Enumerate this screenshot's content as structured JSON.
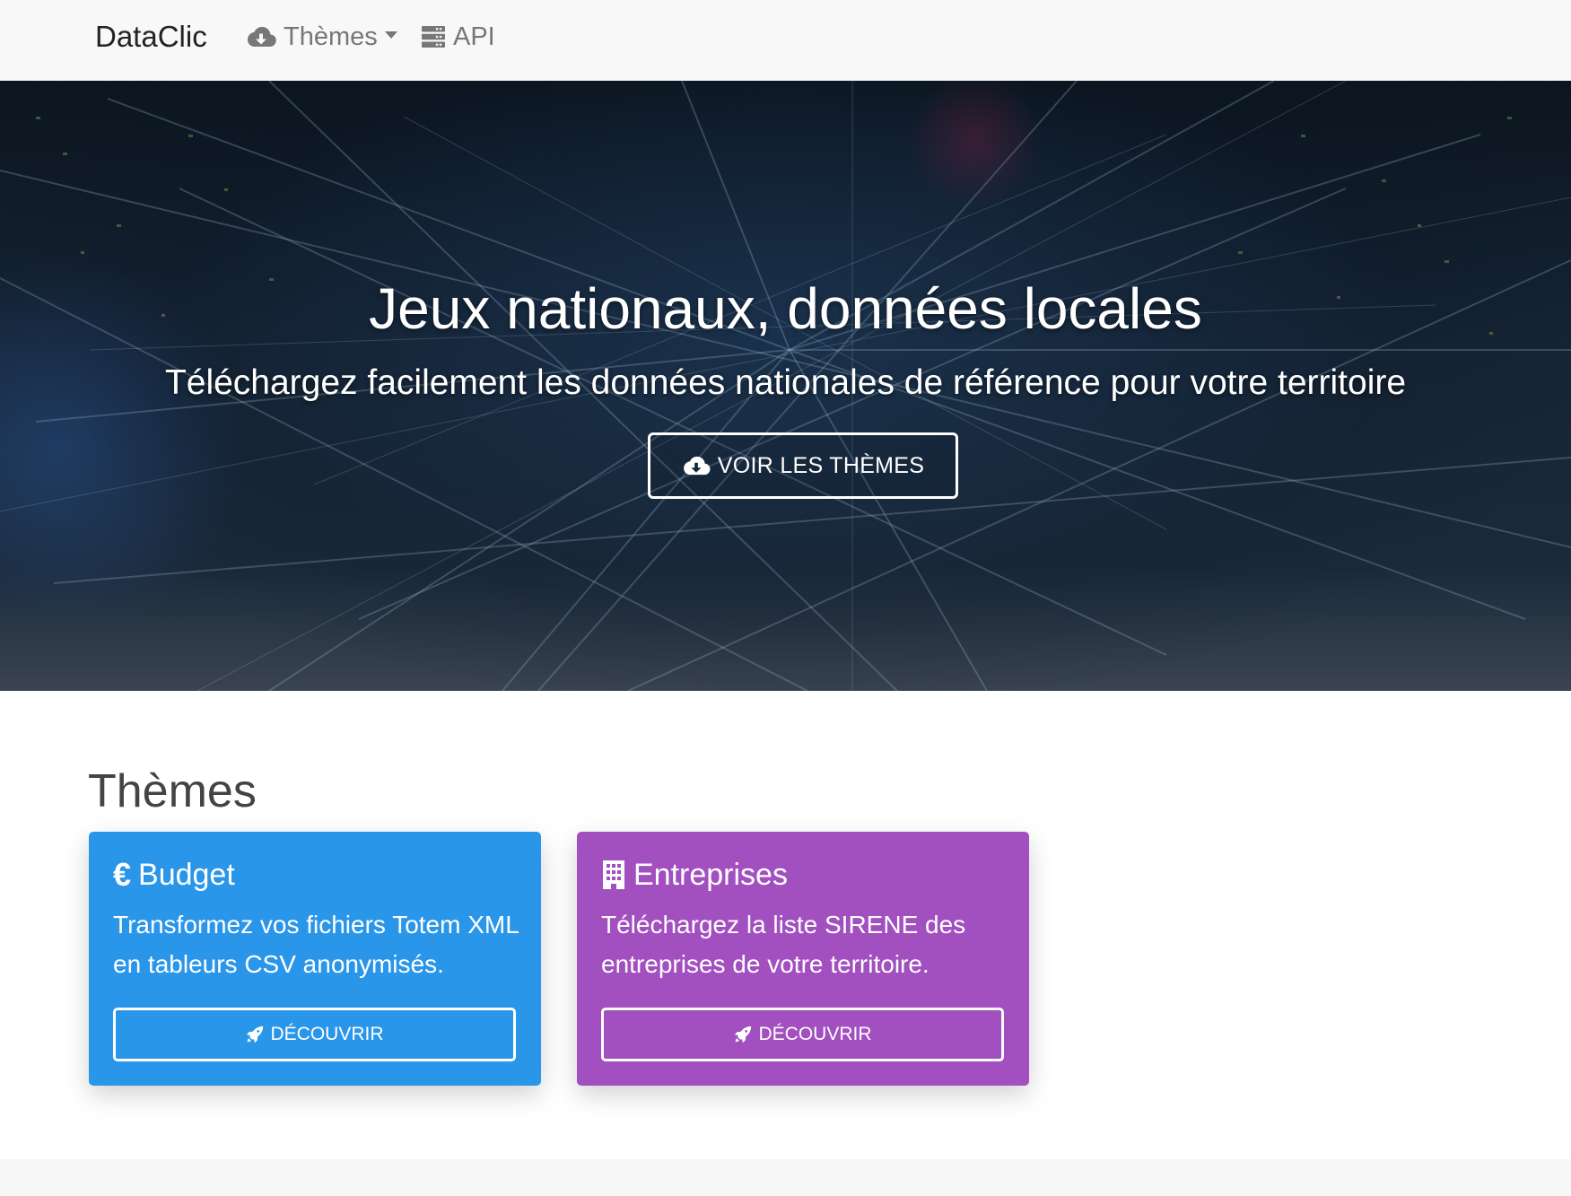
{
  "navbar": {
    "brand": "DataClic",
    "themes_label": "Thèmes",
    "api_label": "API"
  },
  "hero": {
    "title": "Jeux nationaux, données locales",
    "subtitle": "Téléchargez facilement les données nationales de référence pour votre territoire",
    "button_label": "VOIR LES THÈMES"
  },
  "themes": {
    "heading": "Thèmes",
    "cards": [
      {
        "title": "Budget",
        "icon": "euro-icon",
        "text": "Transformez vos fichiers Totem XML en tableurs CSV anonymisés.",
        "button_label": "DÉCOUVRIR",
        "color": "#2a96ea"
      },
      {
        "title": "Entreprises",
        "icon": "building-icon",
        "text": "Téléchargez la liste SIRENE des entreprises de votre territoire.",
        "button_label": "DÉCOUVRIR",
        "color": "#a24fbf"
      }
    ]
  },
  "colors": {
    "navbar_bg": "#f8f8f8",
    "nav_text": "#777777",
    "budget": "#2a96ea",
    "entreprises": "#a24fbf"
  }
}
